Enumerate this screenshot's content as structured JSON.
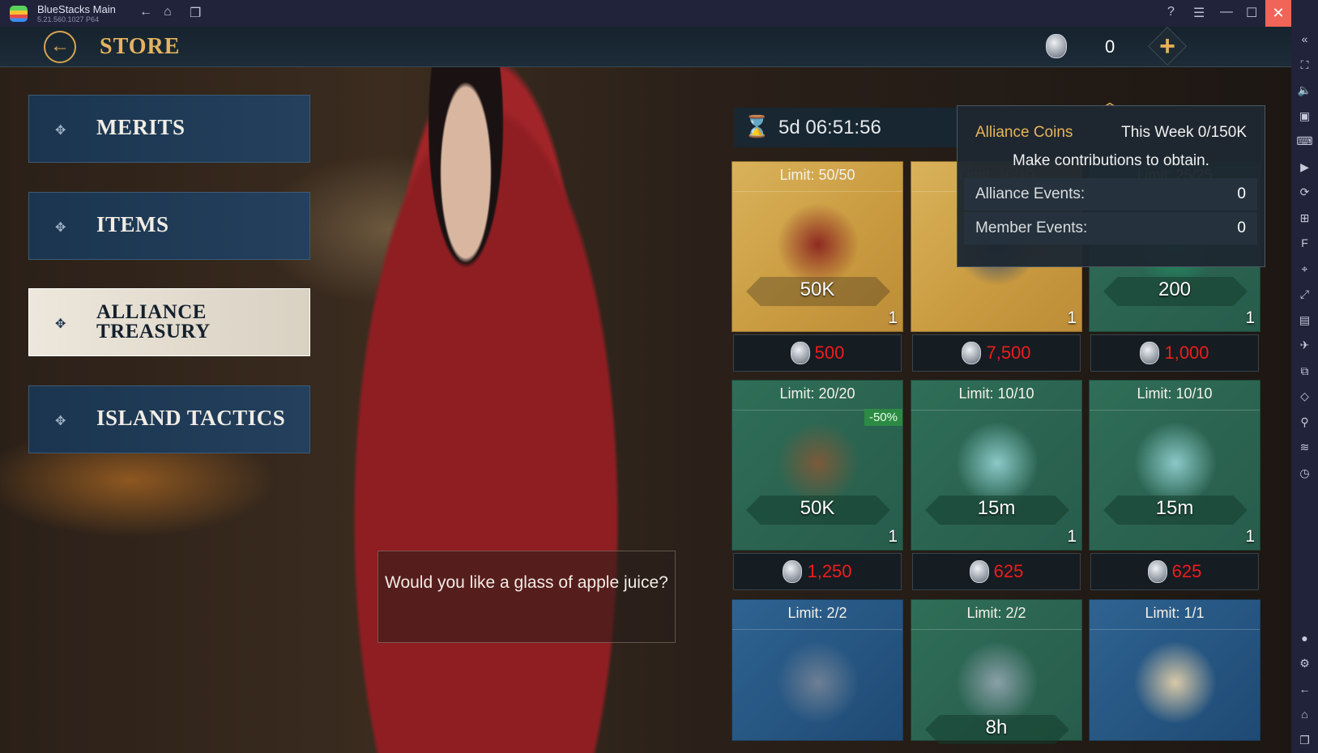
{
  "window": {
    "title": "BlueStacks Main",
    "version": "5.21.560.1027  P64"
  },
  "store": {
    "title": "STORE",
    "currency_count": "0"
  },
  "menu": [
    {
      "label": "MERITS"
    },
    {
      "label": "ITEMS"
    },
    {
      "label": "ALLIANCE TREASURY",
      "active": true
    },
    {
      "label": "ISLAND TACTICS"
    }
  ],
  "timer": "5d 06:51:56",
  "dialog": "Would you like a glass of apple juice?",
  "tooltip": {
    "title": "Alliance Coins",
    "week": "This Week 0/150K",
    "desc": "Make contributions to obtain.",
    "rows": [
      {
        "k": "Alliance Events:",
        "v": "0"
      },
      {
        "k": "Member Events:",
        "v": "0"
      }
    ]
  },
  "cards": [
    {
      "limit": "Limit: 50/50",
      "amount": "50K",
      "qty": "1",
      "price": "500",
      "bg": "gold",
      "item_color": "#8e2a22"
    },
    {
      "limit": "Limit: 10/10",
      "amount": "",
      "qty": "1",
      "price": "7,500",
      "bg": "gold",
      "item_color": "#1f3d6e"
    },
    {
      "limit": "Limit: 25/25",
      "amount": "200",
      "qty": "1",
      "price": "1,000",
      "bg": "green",
      "item_color": "#1f9a6a"
    },
    {
      "limit": "Limit: 20/20",
      "amount": "50K",
      "qty": "1",
      "price": "1,250",
      "bg": "green",
      "discount": "-50%",
      "item_color": "#7a5a3a"
    },
    {
      "limit": "Limit: 10/10",
      "amount": "15m",
      "qty": "1",
      "price": "625",
      "bg": "green",
      "item_color": "#8bc9c8"
    },
    {
      "limit": "Limit: 10/10",
      "amount": "15m",
      "qty": "1",
      "price": "625",
      "bg": "green",
      "item_color": "#8bc9c8"
    },
    {
      "limit": "Limit: 2/2",
      "amount": "",
      "qty": "",
      "price": "",
      "bg": "blue",
      "item_color": "#6d7f94"
    },
    {
      "limit": "Limit: 2/2",
      "amount": "8h",
      "qty": "",
      "price": "",
      "bg": "green",
      "item_color": "#8aa0a8"
    },
    {
      "limit": "Limit: 1/1",
      "amount": "",
      "qty": "",
      "price": "",
      "bg": "blue",
      "item_color": "#d8c9a8"
    }
  ],
  "sidebar_icons": [
    "collapse-icon",
    "fullscreen-icon",
    "volume-icon",
    "screen-record-icon",
    "keyboard-icon",
    "media-icon",
    "rotate-icon",
    "gamepad-icon",
    "fps-icon",
    "screenshot-icon",
    "resize-icon",
    "folder-icon",
    "airplane-icon",
    "multi-instance-icon",
    "eco-mode-icon",
    "location-icon",
    "layers-icon",
    "performance-icon"
  ]
}
